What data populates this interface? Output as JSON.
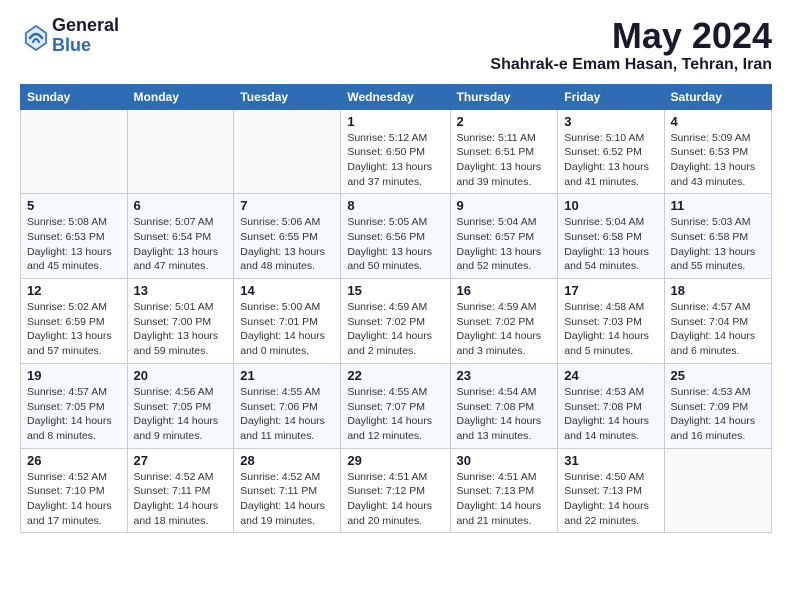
{
  "header": {
    "logo": {
      "general": "General",
      "blue": "Blue"
    },
    "title": "May 2024",
    "location": "Shahrak-e Emam Hasan, Tehran, Iran"
  },
  "calendar": {
    "days": [
      "Sunday",
      "Monday",
      "Tuesday",
      "Wednesday",
      "Thursday",
      "Friday",
      "Saturday"
    ],
    "weeks": [
      [
        {
          "date": "",
          "info": ""
        },
        {
          "date": "",
          "info": ""
        },
        {
          "date": "",
          "info": ""
        },
        {
          "date": "1",
          "info": "Sunrise: 5:12 AM\nSunset: 6:50 PM\nDaylight: 13 hours and 37 minutes."
        },
        {
          "date": "2",
          "info": "Sunrise: 5:11 AM\nSunset: 6:51 PM\nDaylight: 13 hours and 39 minutes."
        },
        {
          "date": "3",
          "info": "Sunrise: 5:10 AM\nSunset: 6:52 PM\nDaylight: 13 hours and 41 minutes."
        },
        {
          "date": "4",
          "info": "Sunrise: 5:09 AM\nSunset: 6:53 PM\nDaylight: 13 hours and 43 minutes."
        }
      ],
      [
        {
          "date": "5",
          "info": "Sunrise: 5:08 AM\nSunset: 6:53 PM\nDaylight: 13 hours and 45 minutes."
        },
        {
          "date": "6",
          "info": "Sunrise: 5:07 AM\nSunset: 6:54 PM\nDaylight: 13 hours and 47 minutes."
        },
        {
          "date": "7",
          "info": "Sunrise: 5:06 AM\nSunset: 6:55 PM\nDaylight: 13 hours and 48 minutes."
        },
        {
          "date": "8",
          "info": "Sunrise: 5:05 AM\nSunset: 6:56 PM\nDaylight: 13 hours and 50 minutes."
        },
        {
          "date": "9",
          "info": "Sunrise: 5:04 AM\nSunset: 6:57 PM\nDaylight: 13 hours and 52 minutes."
        },
        {
          "date": "10",
          "info": "Sunrise: 5:04 AM\nSunset: 6:58 PM\nDaylight: 13 hours and 54 minutes."
        },
        {
          "date": "11",
          "info": "Sunrise: 5:03 AM\nSunset: 6:58 PM\nDaylight: 13 hours and 55 minutes."
        }
      ],
      [
        {
          "date": "12",
          "info": "Sunrise: 5:02 AM\nSunset: 6:59 PM\nDaylight: 13 hours and 57 minutes."
        },
        {
          "date": "13",
          "info": "Sunrise: 5:01 AM\nSunset: 7:00 PM\nDaylight: 13 hours and 59 minutes."
        },
        {
          "date": "14",
          "info": "Sunrise: 5:00 AM\nSunset: 7:01 PM\nDaylight: 14 hours and 0 minutes."
        },
        {
          "date": "15",
          "info": "Sunrise: 4:59 AM\nSunset: 7:02 PM\nDaylight: 14 hours and 2 minutes."
        },
        {
          "date": "16",
          "info": "Sunrise: 4:59 AM\nSunset: 7:02 PM\nDaylight: 14 hours and 3 minutes."
        },
        {
          "date": "17",
          "info": "Sunrise: 4:58 AM\nSunset: 7:03 PM\nDaylight: 14 hours and 5 minutes."
        },
        {
          "date": "18",
          "info": "Sunrise: 4:57 AM\nSunset: 7:04 PM\nDaylight: 14 hours and 6 minutes."
        }
      ],
      [
        {
          "date": "19",
          "info": "Sunrise: 4:57 AM\nSunset: 7:05 PM\nDaylight: 14 hours and 8 minutes."
        },
        {
          "date": "20",
          "info": "Sunrise: 4:56 AM\nSunset: 7:05 PM\nDaylight: 14 hours and 9 minutes."
        },
        {
          "date": "21",
          "info": "Sunrise: 4:55 AM\nSunset: 7:06 PM\nDaylight: 14 hours and 11 minutes."
        },
        {
          "date": "22",
          "info": "Sunrise: 4:55 AM\nSunset: 7:07 PM\nDaylight: 14 hours and 12 minutes."
        },
        {
          "date": "23",
          "info": "Sunrise: 4:54 AM\nSunset: 7:08 PM\nDaylight: 14 hours and 13 minutes."
        },
        {
          "date": "24",
          "info": "Sunrise: 4:53 AM\nSunset: 7:08 PM\nDaylight: 14 hours and 14 minutes."
        },
        {
          "date": "25",
          "info": "Sunrise: 4:53 AM\nSunset: 7:09 PM\nDaylight: 14 hours and 16 minutes."
        }
      ],
      [
        {
          "date": "26",
          "info": "Sunrise: 4:52 AM\nSunset: 7:10 PM\nDaylight: 14 hours and 17 minutes."
        },
        {
          "date": "27",
          "info": "Sunrise: 4:52 AM\nSunset: 7:11 PM\nDaylight: 14 hours and 18 minutes."
        },
        {
          "date": "28",
          "info": "Sunrise: 4:52 AM\nSunset: 7:11 PM\nDaylight: 14 hours and 19 minutes."
        },
        {
          "date": "29",
          "info": "Sunrise: 4:51 AM\nSunset: 7:12 PM\nDaylight: 14 hours and 20 minutes."
        },
        {
          "date": "30",
          "info": "Sunrise: 4:51 AM\nSunset: 7:13 PM\nDaylight: 14 hours and 21 minutes."
        },
        {
          "date": "31",
          "info": "Sunrise: 4:50 AM\nSunset: 7:13 PM\nDaylight: 14 hours and 22 minutes."
        },
        {
          "date": "",
          "info": ""
        }
      ]
    ]
  }
}
